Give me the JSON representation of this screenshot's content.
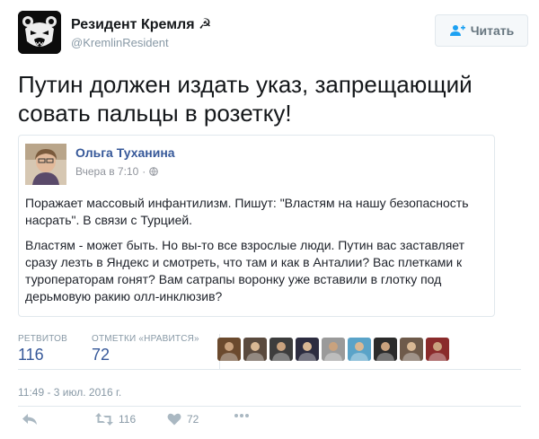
{
  "author": {
    "name": "Резидент Кремля ☭",
    "handle": "@KremlinResident",
    "avatar_icon": "bear-face-icon"
  },
  "follow_button": {
    "label": "Читать",
    "icon": "add-user-icon"
  },
  "tweet": {
    "text": "Путин должен издать указ, запрещающий совать пальцы в розетку!"
  },
  "quoted_post": {
    "author_name": "Ольга Туханина",
    "time": "Вчера в 7:10",
    "separator": "·",
    "visibility_icon": "globe-icon",
    "paragraph_1": "Поражает массовый инфантилизм. Пишут: \"Властям на нашу безопасность насрать\". В связи с Турцией.",
    "paragraph_2": "Властям - может быть. Но вы-то все взрослые люди. Путин вас заставляет сразу лезть в Яндекс и смотреть, что там и как в Анталии? Вас плетками к туроператорам гонят? Вам сатрапы воронку уже вставили в глотку под дерьмовую ракию олл-инклюзив?"
  },
  "stats": {
    "retweets_label": "РЕТВИТОВ",
    "retweets_value": "116",
    "likes_label": "ОТМЕТКИ «НРАВИТСЯ»",
    "likes_value": "72"
  },
  "likers": [
    {
      "name": "liker-avatar-1",
      "color": "#6b4a2e"
    },
    {
      "name": "liker-avatar-2",
      "color": "#5a4a3e"
    },
    {
      "name": "liker-avatar-3",
      "color": "#3d3d3d"
    },
    {
      "name": "liker-avatar-4",
      "color": "#2d2d40"
    },
    {
      "name": "liker-avatar-5",
      "color": "#9a9a9a"
    },
    {
      "name": "liker-avatar-6",
      "color": "#5aa3c8"
    },
    {
      "name": "liker-avatar-7",
      "color": "#2b2b2b"
    },
    {
      "name": "liker-avatar-8",
      "color": "#6e5a4a"
    },
    {
      "name": "liker-avatar-9",
      "color": "#8a2b2b"
    }
  ],
  "timestamp": "11:49 - 3 июл. 2016 г.",
  "actions": {
    "reply_icon": "reply-icon",
    "retweet_icon": "retweet-icon",
    "retweet_count": "116",
    "like_icon": "heart-icon",
    "like_count": "72",
    "more_icon": "more-dots-icon"
  },
  "colors": {
    "link": "#365899",
    "muted": "#8899a6",
    "text": "#14171a",
    "border": "#e1e8ed"
  }
}
